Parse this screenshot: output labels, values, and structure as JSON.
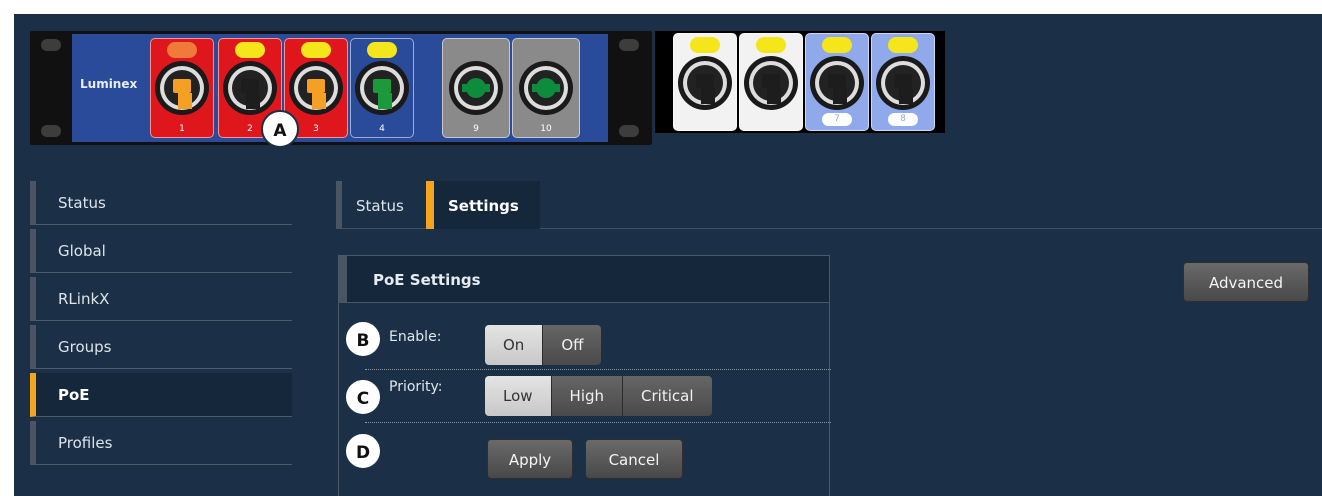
{
  "device": {
    "brand": "Luminex",
    "ports": [
      {
        "num": "1",
        "led": "#f07a3a",
        "bg": "#e0161d",
        "jack": "#f5a024"
      },
      {
        "num": "2",
        "led": "#f4e61a",
        "bg": "#e0161d",
        "jack": "#1d1d1d"
      },
      {
        "num": "3",
        "led": "#f4e61a",
        "bg": "#e0161d",
        "jack": "#f5a024"
      },
      {
        "num": "4",
        "led": "#f4e61a",
        "bg": "#2a4b9a",
        "jack": "#1a9a3a"
      },
      {
        "num": "9",
        "bg": "#8a8a8a"
      },
      {
        "num": "10",
        "bg": "#8a8a8a"
      },
      {
        "num": "",
        "led": "#f4e61a",
        "bg": "#f2f2f2"
      },
      {
        "num": "",
        "led": "#f4e61a",
        "bg": "#f2f2f2"
      },
      {
        "num": "7",
        "led": "#f4e61a",
        "bg": "#8fa9ea"
      },
      {
        "num": "8",
        "led": "#f4e61a",
        "bg": "#8fa9ea"
      }
    ]
  },
  "sidebar": {
    "items": [
      {
        "label": "Status"
      },
      {
        "label": "Global"
      },
      {
        "label": "RLinkX"
      },
      {
        "label": "Groups"
      },
      {
        "label": "PoE"
      },
      {
        "label": "Profiles"
      }
    ],
    "active": "PoE"
  },
  "tabs": {
    "status": "Status",
    "settings": "Settings",
    "active": "Settings"
  },
  "advanced_label": "Advanced",
  "poe": {
    "title": "PoE Settings",
    "enable": {
      "label": "Enable:",
      "options": [
        "On",
        "Off"
      ],
      "selected": "On"
    },
    "priority": {
      "label": "Priority:",
      "options": [
        "Low",
        "High",
        "Critical"
      ],
      "selected": "Low"
    },
    "apply_label": "Apply",
    "cancel_label": "Cancel"
  },
  "markers": {
    "a": "A",
    "b": "B",
    "c": "C",
    "d": "D"
  },
  "colors": {
    "background": "#1b3047",
    "accent": "#f3a51d"
  }
}
